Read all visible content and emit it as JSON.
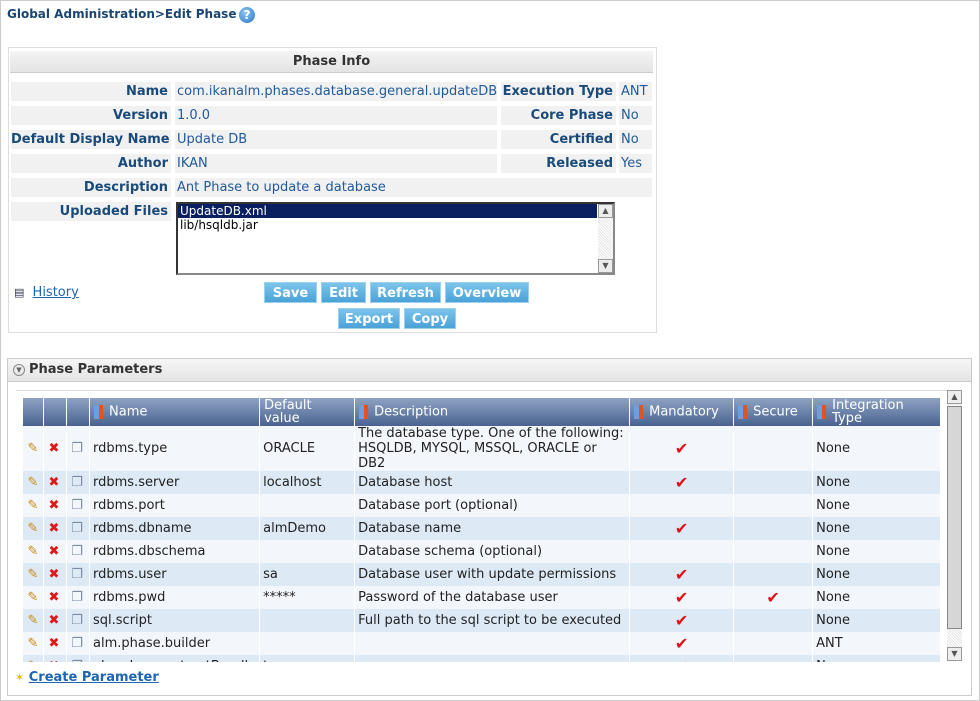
{
  "breadcrumb": "Global Administration>Edit Phase",
  "phase_info": {
    "title": "Phase Info",
    "fields": [
      {
        "label": "Name",
        "value": "com.ikanalm.phases.database.general.updateDB",
        "label2": "Execution Type",
        "value2": "ANT"
      },
      {
        "label": "Version",
        "value": "1.0.0",
        "label2": "Core Phase",
        "value2": "No"
      },
      {
        "label": "Default Display Name",
        "value": "Update DB",
        "label2": "Certified",
        "value2": "No"
      },
      {
        "label": "Author",
        "value": "IKAN",
        "label2": "Released",
        "value2": "Yes"
      },
      {
        "label": "Description",
        "value": "Ant Phase to update a database"
      }
    ],
    "uploaded_label": "Uploaded Files",
    "files": [
      "UpdateDB.xml",
      "lib/hsqldb.jar"
    ],
    "selected_file": "UpdateDB.xml",
    "history_label": "History",
    "buttons": {
      "save": "Save",
      "edit": "Edit",
      "refresh": "Refresh",
      "overview": "Overview",
      "export": "Export",
      "copy": "Copy"
    }
  },
  "phase_parameters": {
    "title": "Phase Parameters",
    "columns": [
      "Name",
      "Default value",
      "Description",
      "Mandatory",
      "Secure",
      "Integration Type"
    ],
    "rows": [
      {
        "name": "rdbms.type",
        "default": "ORACLE",
        "description": "The database type. One of the following: HSQLDB, MYSQL, MSSQL, ORACLE or DB2",
        "mandatory": true,
        "secure": false,
        "integration": "None"
      },
      {
        "name": "rdbms.server",
        "default": "localhost",
        "description": "Database host",
        "mandatory": true,
        "secure": false,
        "integration": "None"
      },
      {
        "name": "rdbms.port",
        "default": "",
        "description": "Database port (optional)",
        "mandatory": false,
        "secure": false,
        "integration": "None"
      },
      {
        "name": "rdbms.dbname",
        "default": "almDemo",
        "description": "Database name",
        "mandatory": true,
        "secure": false,
        "integration": "None"
      },
      {
        "name": "rdbms.dbschema",
        "default": "",
        "description": "Database schema (optional)",
        "mandatory": false,
        "secure": false,
        "integration": "None"
      },
      {
        "name": "rdbms.user",
        "default": "sa",
        "description": "Database user with update permissions",
        "mandatory": true,
        "secure": false,
        "integration": "None"
      },
      {
        "name": "rdbms.pwd",
        "default": "*****",
        "description": "Password of the database user",
        "mandatory": true,
        "secure": true,
        "integration": "None"
      },
      {
        "name": "sql.script",
        "default": "",
        "description": "Full path to the sql script to be executed",
        "mandatory": true,
        "secure": false,
        "integration": "None"
      },
      {
        "name": "alm.phase.builder",
        "default": "",
        "description": "",
        "mandatory": true,
        "secure": false,
        "integration": "ANT"
      },
      {
        "name": "alm.phase.extractBundle",
        "default": "true",
        "description": "",
        "mandatory": true,
        "secure": false,
        "integration": "None"
      }
    ],
    "create_label": "Create Parameter"
  },
  "colors": {
    "header_blue": "#4a6390",
    "label_blue": "#1a4a7a",
    "button_blue": "#4aa2d8",
    "check_red": "#e0101a"
  }
}
